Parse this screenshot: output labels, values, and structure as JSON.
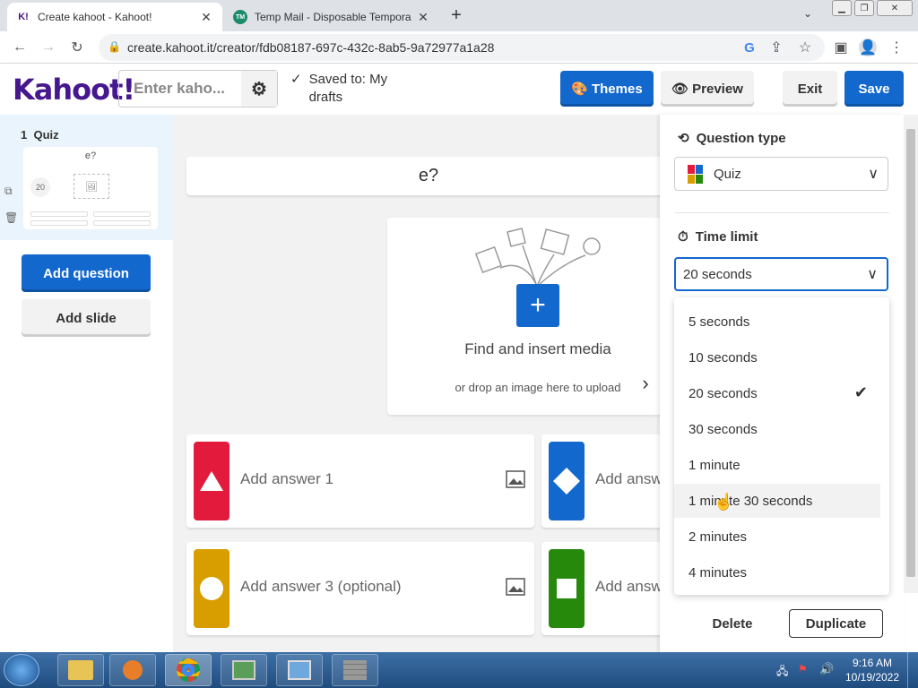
{
  "browser": {
    "tabs": [
      {
        "title": "Create kahoot - Kahoot!",
        "favicon": "K!"
      },
      {
        "title": "Temp Mail - Disposable Tempora",
        "favicon": "TM"
      }
    ],
    "new_tab": "+",
    "url": "create.kahoot.it/creator/fdb08187-697c-432c-8ab5-9a72977a1a28"
  },
  "header": {
    "logo": "Kahoot!",
    "title_placeholder": "Enter kaho...",
    "saved_line1": "Saved to: My",
    "saved_line2": "drafts",
    "themes": "Themes",
    "preview": "Preview",
    "exit": "Exit",
    "save": "Save"
  },
  "sidebar": {
    "slide_number": "1",
    "slide_type": "Quiz",
    "thumb_question": "e?",
    "thumb_time": "20",
    "add_question": "Add question",
    "add_slide": "Add slide"
  },
  "editor": {
    "question": "e?",
    "media_title": "Find and insert media",
    "media_sub": "or drop an image here to upload",
    "answers": [
      "Add answer 1",
      "Add answ",
      "Add answer 3 (optional)",
      "Add answ"
    ]
  },
  "panel": {
    "question_type_label": "Question type",
    "question_type_value": "Quiz",
    "time_limit_label": "Time limit",
    "time_limit_value": "20 seconds",
    "options": [
      "5 seconds",
      "10 seconds",
      "20 seconds",
      "30 seconds",
      "1 minute",
      "1 minute 30 seconds",
      "2 minutes",
      "4 minutes"
    ],
    "selected_option": "20 seconds",
    "delete": "Delete",
    "duplicate": "Duplicate"
  },
  "taskbar": {
    "time": "9:16 AM",
    "date": "10/19/2022"
  },
  "colors": {
    "kahoot_purple": "#46178f",
    "blue": "#1368ce",
    "red": "#e21b3c",
    "answer_blue": "#1368ce",
    "yellow": "#d89e00",
    "green": "#26890c"
  }
}
